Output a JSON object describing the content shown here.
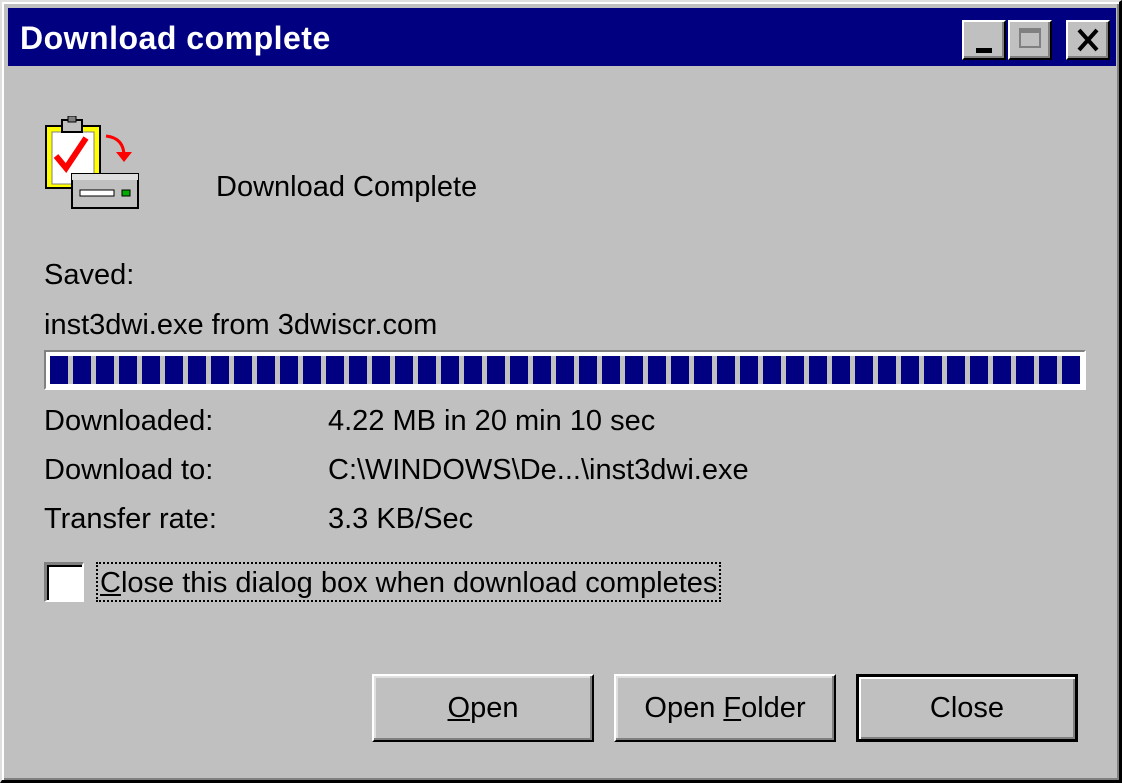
{
  "window": {
    "title": "Download complete",
    "controls": {
      "minimize_icon": "minimize-icon",
      "maximize_icon": "maximize-icon",
      "close_icon": "close-icon"
    }
  },
  "content": {
    "icon": "download-complete-icon",
    "heading": "Download Complete",
    "saved_label": "Saved:",
    "saved_value": "inst3dwi.exe from 3dwiscr.com",
    "progress_fraction": 1.0,
    "details": [
      {
        "label": "Downloaded:",
        "value": "4.22 MB in 20 min 10 sec"
      },
      {
        "label": "Download to:",
        "value": "C:\\WINDOWS\\De...\\inst3dwi.exe"
      },
      {
        "label": "Transfer rate:",
        "value": "3.3 KB/Sec"
      }
    ],
    "checkbox": {
      "checked": false,
      "label_mnemonic": "C",
      "label_rest": "lose this dialog box when download completes"
    }
  },
  "buttons": {
    "open": {
      "mnemonic": "O",
      "rest": "pen"
    },
    "open_folder": {
      "prefix": "Open ",
      "mnemonic": "F",
      "rest": "older"
    },
    "close": {
      "label": "Close"
    }
  },
  "colors": {
    "titlebar": "#000080",
    "face": "#c0c0c0",
    "progress": "#000080"
  }
}
